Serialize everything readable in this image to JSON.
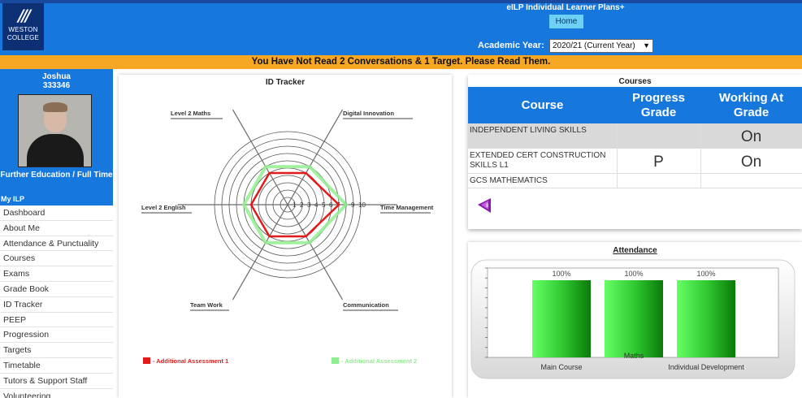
{
  "header": {
    "logo_line1": "WESTON",
    "logo_line2": "COLLEGE",
    "app_title": "eILP Individual Learner Plans+",
    "home_label": "Home",
    "academic_year_label": "Academic Year:",
    "academic_year_value": "2020/21 (Current Year)"
  },
  "alert": "You Have Not Read 2 Conversations & 1 Target. Please Read Them.",
  "profile": {
    "name": "Joshua",
    "student_id": "333346",
    "programme": "Further Education / Full Time",
    "section_label": "My ILP"
  },
  "nav": [
    "Dashboard",
    "About Me",
    "Attendance & Punctuality",
    "Courses",
    "Exams",
    "Grade Book",
    "ID Tracker",
    "PEEP",
    "Progression",
    "Targets",
    "Timetable",
    "Tutors & Support Staff",
    "Volunteering"
  ],
  "id_tracker": {
    "title": "ID Tracker",
    "axes": [
      "Level 2 Maths",
      "Digital Innovation",
      "Time Management",
      "Communication",
      "Team Work",
      "Level 2 English"
    ],
    "scale_labels": [
      "1",
      "2",
      "3",
      "4",
      "5",
      "6",
      "7",
      "8",
      "9",
      "10"
    ],
    "legend": [
      "- Additional Assessment 1",
      "- Additional Assessment 2"
    ],
    "colors": {
      "series1": "#e11b1b",
      "series2": "#90ee90",
      "rings": "#555555"
    }
  },
  "chart_data": [
    {
      "type": "radar",
      "categories": [
        "Level 2 Maths",
        "Digital Innovation",
        "Time Management",
        "Communication",
        "Team Work",
        "Level 2 English"
      ],
      "rmax": 10,
      "series": [
        {
          "name": "Additional Assessment 1",
          "values": [
            5,
            5,
            7,
            5,
            5,
            5
          ]
        },
        {
          "name": "Additional Assessment 2",
          "values": [
            6,
            6,
            8,
            6,
            6,
            6
          ]
        }
      ]
    },
    {
      "type": "bar",
      "title": "Attendance",
      "categories": [
        "Main Course",
        "Maths",
        "Individual Development"
      ],
      "values": [
        100,
        100,
        100
      ],
      "data_labels": [
        "100%",
        "100%",
        "100%"
      ],
      "ylim": [
        0,
        100
      ],
      "grid": false
    }
  ],
  "courses": {
    "title": "Courses",
    "headers": [
      "Course",
      "Progress Grade",
      "Working At Grade"
    ],
    "rows": [
      {
        "course": "INDEPENDENT LIVING SKILLS",
        "progress": "",
        "working": "On"
      },
      {
        "course": "EXTENDED CERT CONSTRUCTION SKILLS L1",
        "progress": "P",
        "working": "On"
      },
      {
        "course": "GCS MATHEMATICS",
        "progress": "",
        "working": ""
      }
    ]
  },
  "attendance": {
    "title": "Attendance",
    "colors": {
      "bar_light": "#66ff66",
      "bar_dark": "#0a7a0a"
    }
  }
}
